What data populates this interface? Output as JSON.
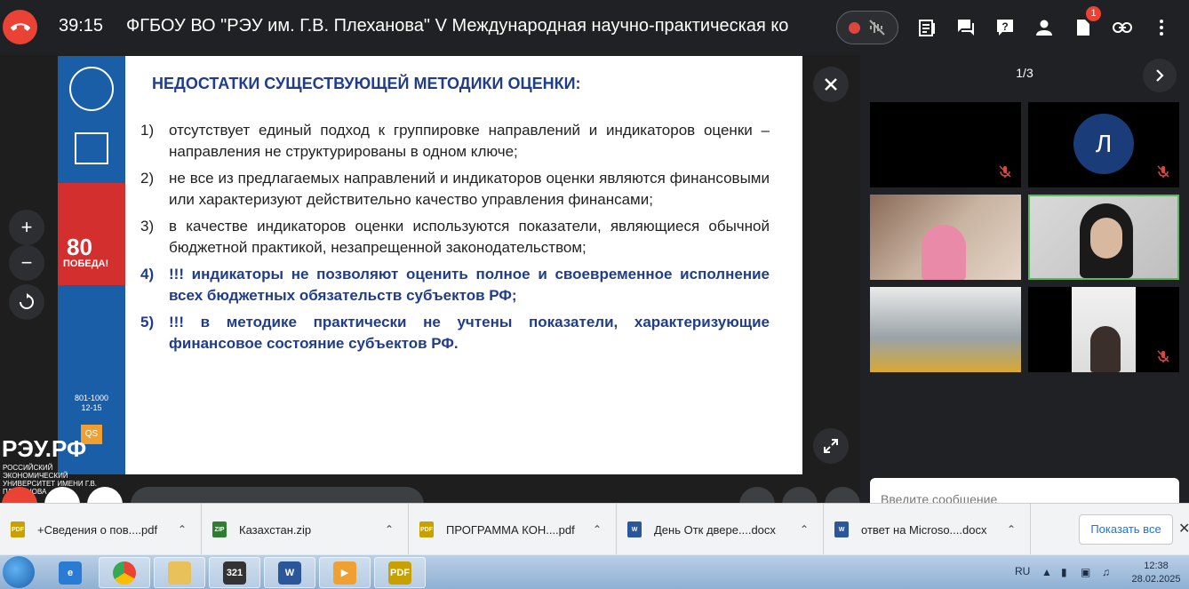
{
  "topbar": {
    "timer": "39:15",
    "title": "ФГБОУ ВО \"РЭУ им. Г.В. Плеханова\"    V Международная научно-практическая ко",
    "participants_badge": "1"
  },
  "slide": {
    "title": "НЕДОСТАТКИ СУЩЕСТВУЮЩЕЙ МЕТОДИКИ ОЦЕНКИ:",
    "items": [
      {
        "num": "1)",
        "text": "отсутствует единый подход к группировке направлений и индикаторов оценки – направления не структурированы в одном ключе;"
      },
      {
        "num": "2)",
        "text": "не все из предлагаемых направлений и индикаторов оценки являются финансовыми или характеризуют действительно качество управления финансами;"
      },
      {
        "num": "3)",
        "text": "в качестве индикаторов оценки используются показатели, являющиеся обычной бюджетной практикой, незапрещенной законодательством;"
      },
      {
        "num": "4)",
        "text": "!!! индикаторы не позволяют оценить полное и своевременное исполнение всех бюджетных обязательств субъектов РФ;"
      },
      {
        "num": "5)",
        "text": "!!! в методике практически не учтены показатели, характеризующие финансовое состояние субъектов РФ."
      }
    ],
    "strip_80": "80",
    "strip_pobeda": "ПОБЕДА!",
    "strip_rank": "801-1000\n12-15",
    "strip_qs": "QS",
    "logo_main": "РЭУ.РФ",
    "logo_sub": "РОССИЙСКИЙ ЭКОНОМИЧЕСКИЙ УНИВЕРСИТЕТ ИМЕНИ Г.В. ПЛЕХАНОВА"
  },
  "stage": {
    "zoom_in": "+",
    "zoom_out": "−"
  },
  "right": {
    "pager": "1/3",
    "avatar_letter": "Л",
    "chat_placeholder": "Введите сообщение"
  },
  "downloads": [
    {
      "name": "+Сведения о пов....pdf",
      "type": "PDF"
    },
    {
      "name": "Казахстан.zip",
      "type": "ZIP"
    },
    {
      "name": "ПРОГРАММА КОН....pdf",
      "type": "PDF"
    },
    {
      "name": "День Отк двере....docx",
      "type": "W"
    },
    {
      "name": "ответ на Microso....docx",
      "type": "W"
    }
  ],
  "downloads_show_all": "Показать все",
  "taskbar": {
    "lang": "RU",
    "time": "12:38",
    "date": "28.02.2025",
    "apps": [
      "ie",
      "chrome",
      "explorer",
      "media-321",
      "word",
      "media-player",
      "pdf"
    ]
  },
  "colors": {
    "accent_red": "#ea4335",
    "slide_blue": "#1f3d8c",
    "active_tile": "#5bb85d"
  }
}
